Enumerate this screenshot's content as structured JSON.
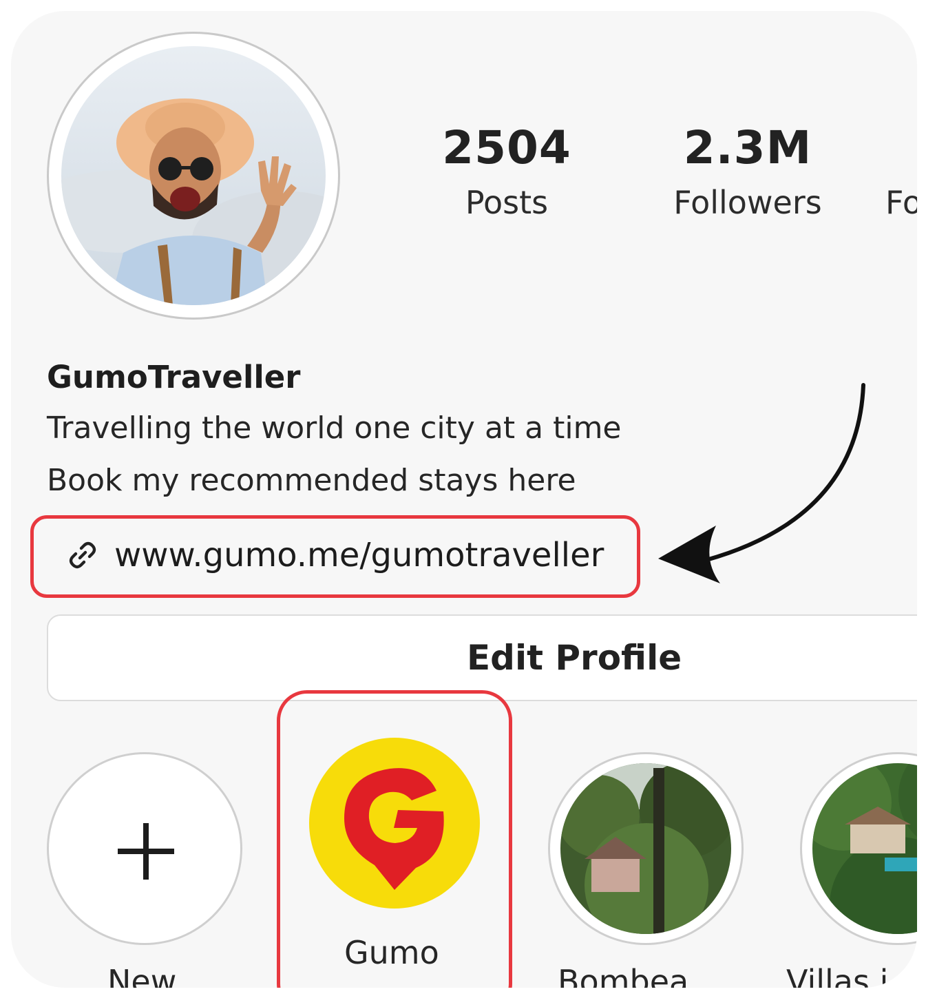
{
  "profile": {
    "username": "GumoTraveller",
    "bio_line_1": "Travelling the world one city at a time",
    "bio_line_2": "Book my recommended stays here",
    "link": "www.gumo.me/gumotraveller"
  },
  "stats": {
    "posts_count": "2504",
    "posts_label": "Posts",
    "followers_count": "2.3M",
    "followers_label": "Followers",
    "following_label_partial": "Fo"
  },
  "actions": {
    "edit_profile": "Edit Profile"
  },
  "highlights": [
    {
      "label": "New",
      "icon": "plus-icon"
    },
    {
      "label": "Gumo",
      "icon": "gumo-logo"
    },
    {
      "label": "Bombea",
      "icon": "villa-photo"
    },
    {
      "label": "Villas i",
      "icon": "villa-photo"
    }
  ],
  "colors": {
    "highlight_box": "#e8383f",
    "gumo_yellow": "#f7dc0a",
    "gumo_red": "#e01f25"
  }
}
